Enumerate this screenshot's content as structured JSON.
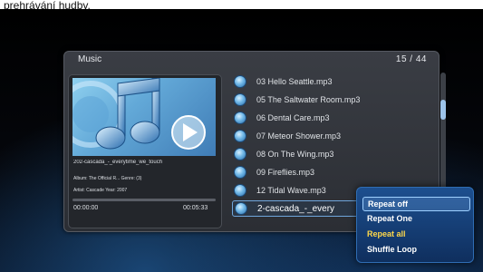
{
  "caption": "prehrávání hudby.",
  "header": {
    "title": "Music",
    "counter": "15 / 44"
  },
  "now_playing": {
    "filename": "202-cascada_-_everytime_we_touch",
    "album_genre": "Album: The Official R... Genre: (3)",
    "artist_year": "Artist: Cascade       Year: 2007",
    "time_current": "00:00:00",
    "time_total": "00:05:33",
    "progress": 0.0
  },
  "playlist": [
    {
      "label": "03 Hello Seattle.mp3"
    },
    {
      "label": "05 The Saltwater Room.mp3"
    },
    {
      "label": "06 Dental Care.mp3"
    },
    {
      "label": "07 Meteor Shower.mp3"
    },
    {
      "label": "08 On The Wing.mp3"
    },
    {
      "label": "09 Fireflies.mp3"
    },
    {
      "label": "12 Tidal Wave.mp3"
    },
    {
      "label": "2-cascada_-_every"
    }
  ],
  "repeat_menu": {
    "options": [
      "Repeat off",
      "Repeat One",
      "Repeat all",
      "Shuffle Loop"
    ],
    "focused": "Repeat off",
    "active": "Repeat all"
  },
  "colors": {
    "accent": "#6fa6dc",
    "active_option": "#ffd84a",
    "popup_bg": "#1d4f8f"
  },
  "icons": {
    "file": "music-file-icon",
    "art": "music-note-icon",
    "play": "play-icon"
  }
}
